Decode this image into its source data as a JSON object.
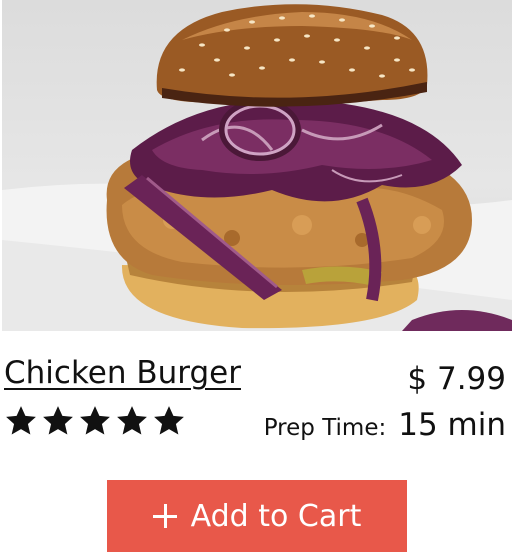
{
  "product": {
    "title": "Chicken Burger",
    "price": "$ 7.99",
    "rating": 5,
    "rating_max": 5,
    "prep_label": "Prep Time:",
    "prep_value": "15 min"
  },
  "actions": {
    "add_to_cart_label": "Add to Cart",
    "add_to_cart_icon": "plus-icon"
  },
  "colors": {
    "button_bg": "#e8584a",
    "text": "#111111",
    "star": "#111111"
  }
}
